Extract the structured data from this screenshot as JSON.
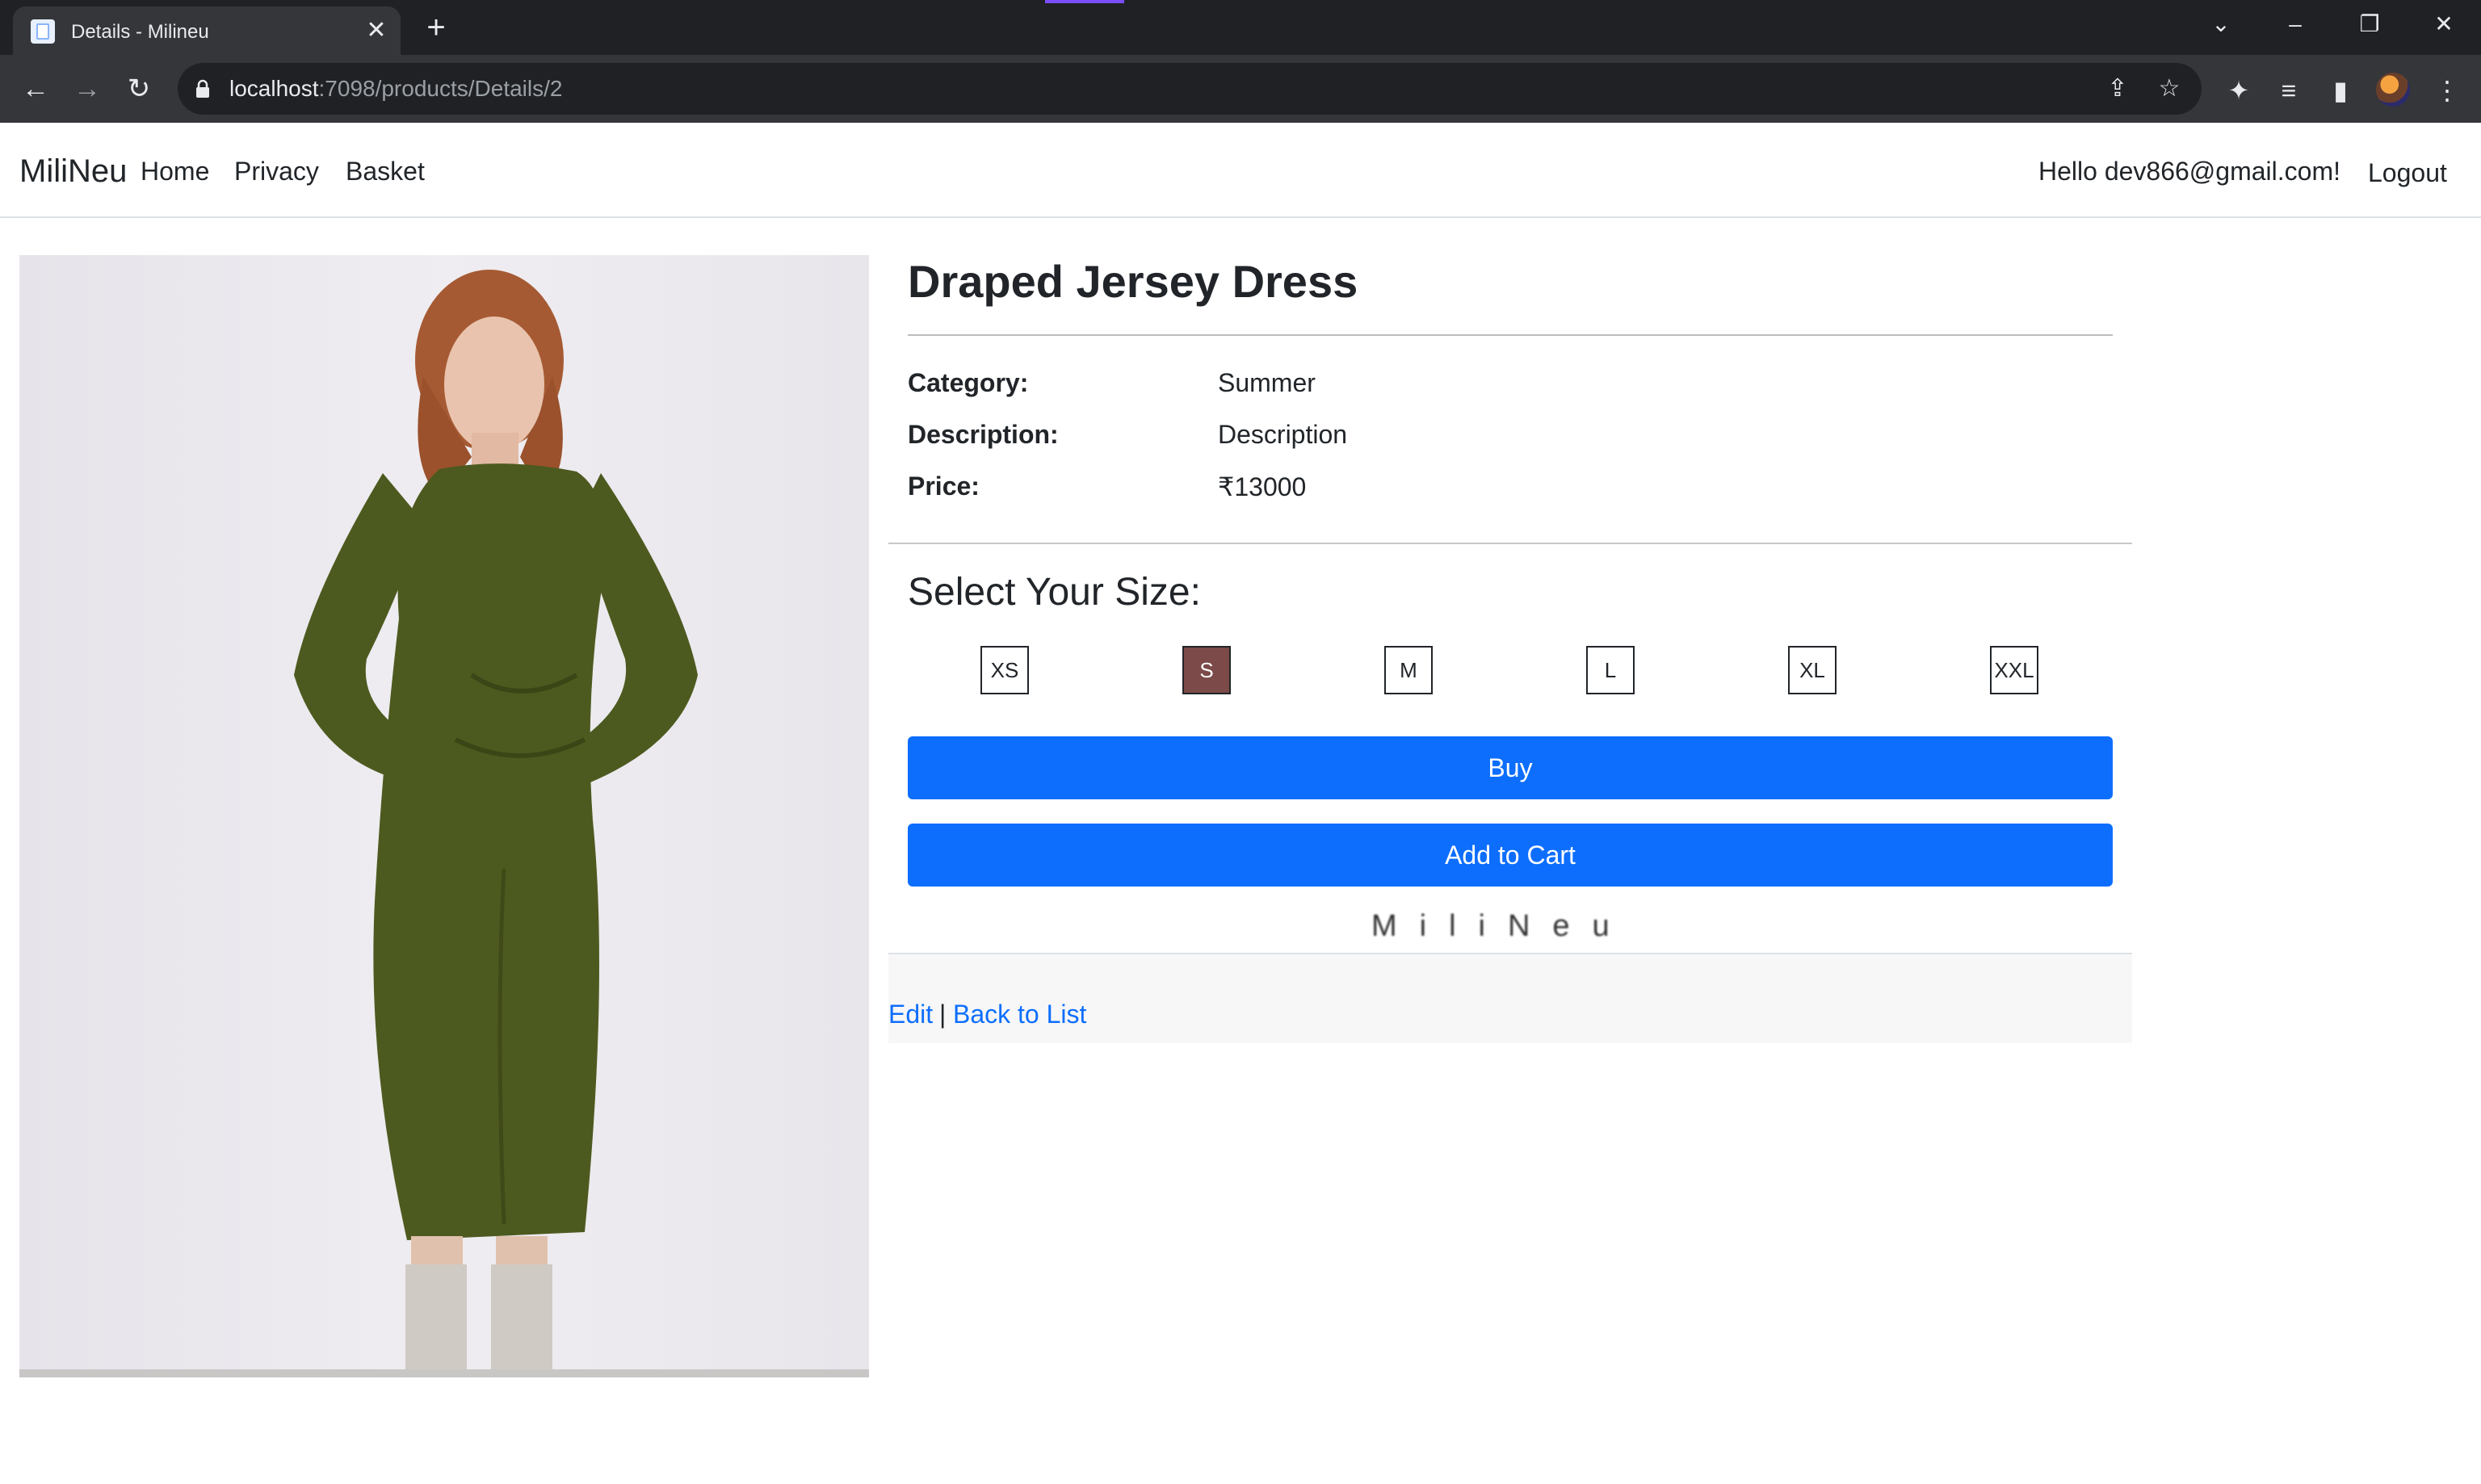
{
  "browser": {
    "tab_title": "Details - Milineu",
    "url_host": "localhost",
    "url_rest": ":7098/products/Details/2"
  },
  "nav": {
    "brand": "MiliNeu",
    "links": [
      "Home",
      "Privacy",
      "Basket"
    ],
    "greeting": "Hello dev866@gmail.com!",
    "logout": "Logout"
  },
  "product": {
    "title": "Draped Jersey Dress",
    "details": [
      {
        "label": "Category:",
        "value": "Summer"
      },
      {
        "label": "Description:",
        "value": "Description"
      },
      {
        "label": "Price:",
        "value": "₹13000"
      }
    ],
    "dress_color": "#4d5a1f"
  },
  "size_select": {
    "heading": "Select Your Size:",
    "sizes": [
      "XS",
      "S",
      "M",
      "L",
      "XL",
      "XXL"
    ],
    "selected": "S",
    "selected_color": "#7c4a48"
  },
  "actions": {
    "buy": "Buy",
    "add_to_cart": "Add to Cart",
    "accent": "#0d6efd"
  },
  "watermark": "MiliNeu",
  "footer_links": {
    "edit": "Edit",
    "separator": "|",
    "back": "Back to List"
  }
}
